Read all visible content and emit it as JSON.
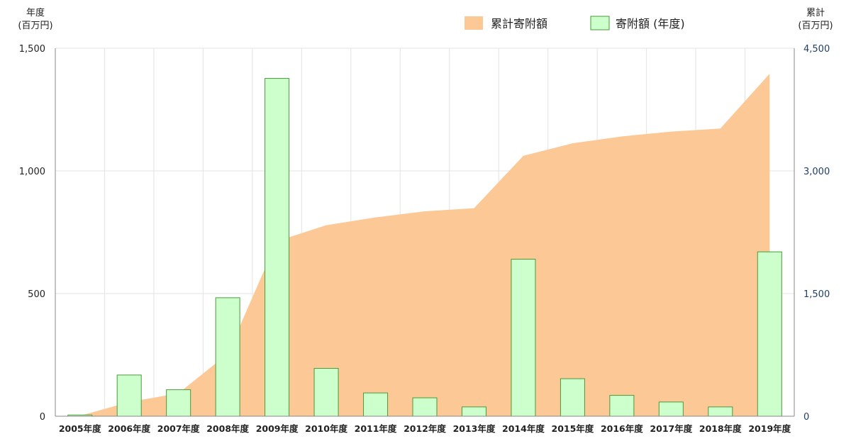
{
  "chart_data": {
    "type": "bar",
    "categories": [
      "2005年度",
      "2006年度",
      "2007年度",
      "2008年度",
      "2009年度",
      "2010年度",
      "2011年度",
      "2012年度",
      "2013年度",
      "2014年度",
      "2015年度",
      "2016年度",
      "2017年度",
      "2018年度",
      "2019年度"
    ],
    "series": [
      {
        "name": "寄附額 (年度)",
        "type": "bar",
        "axis": "left",
        "color": "#ccffcc",
        "stroke": "#4a9a3a",
        "values": [
          5,
          168,
          108,
          483,
          1377,
          195,
          95,
          75,
          38,
          640,
          153,
          85,
          58,
          38,
          670
        ]
      },
      {
        "name": "累計寄附額",
        "type": "area",
        "axis": "right",
        "color": "#fcc896",
        "values": [
          5,
          173,
          281,
          764,
          2141,
          2336,
          2431,
          2506,
          2544,
          3184,
          3337,
          3422,
          3480,
          3518,
          4188
        ]
      }
    ],
    "left_axis": {
      "title_lines": [
        "年度",
        "(百万円)"
      ],
      "ylim": [
        0,
        1500
      ],
      "ticks": [
        0,
        500,
        1000,
        1500
      ],
      "tick_labels": [
        "0",
        "500",
        "1,000",
        "1,500"
      ]
    },
    "right_axis": {
      "title_lines": [
        "累計",
        "(百万円)"
      ],
      "ylim": [
        0,
        4500
      ],
      "ticks": [
        0,
        1500,
        3000,
        4500
      ],
      "tick_labels": [
        "0",
        "1,500",
        "3,000",
        "4,500"
      ]
    },
    "grid": true,
    "legend_position": "top-right"
  }
}
